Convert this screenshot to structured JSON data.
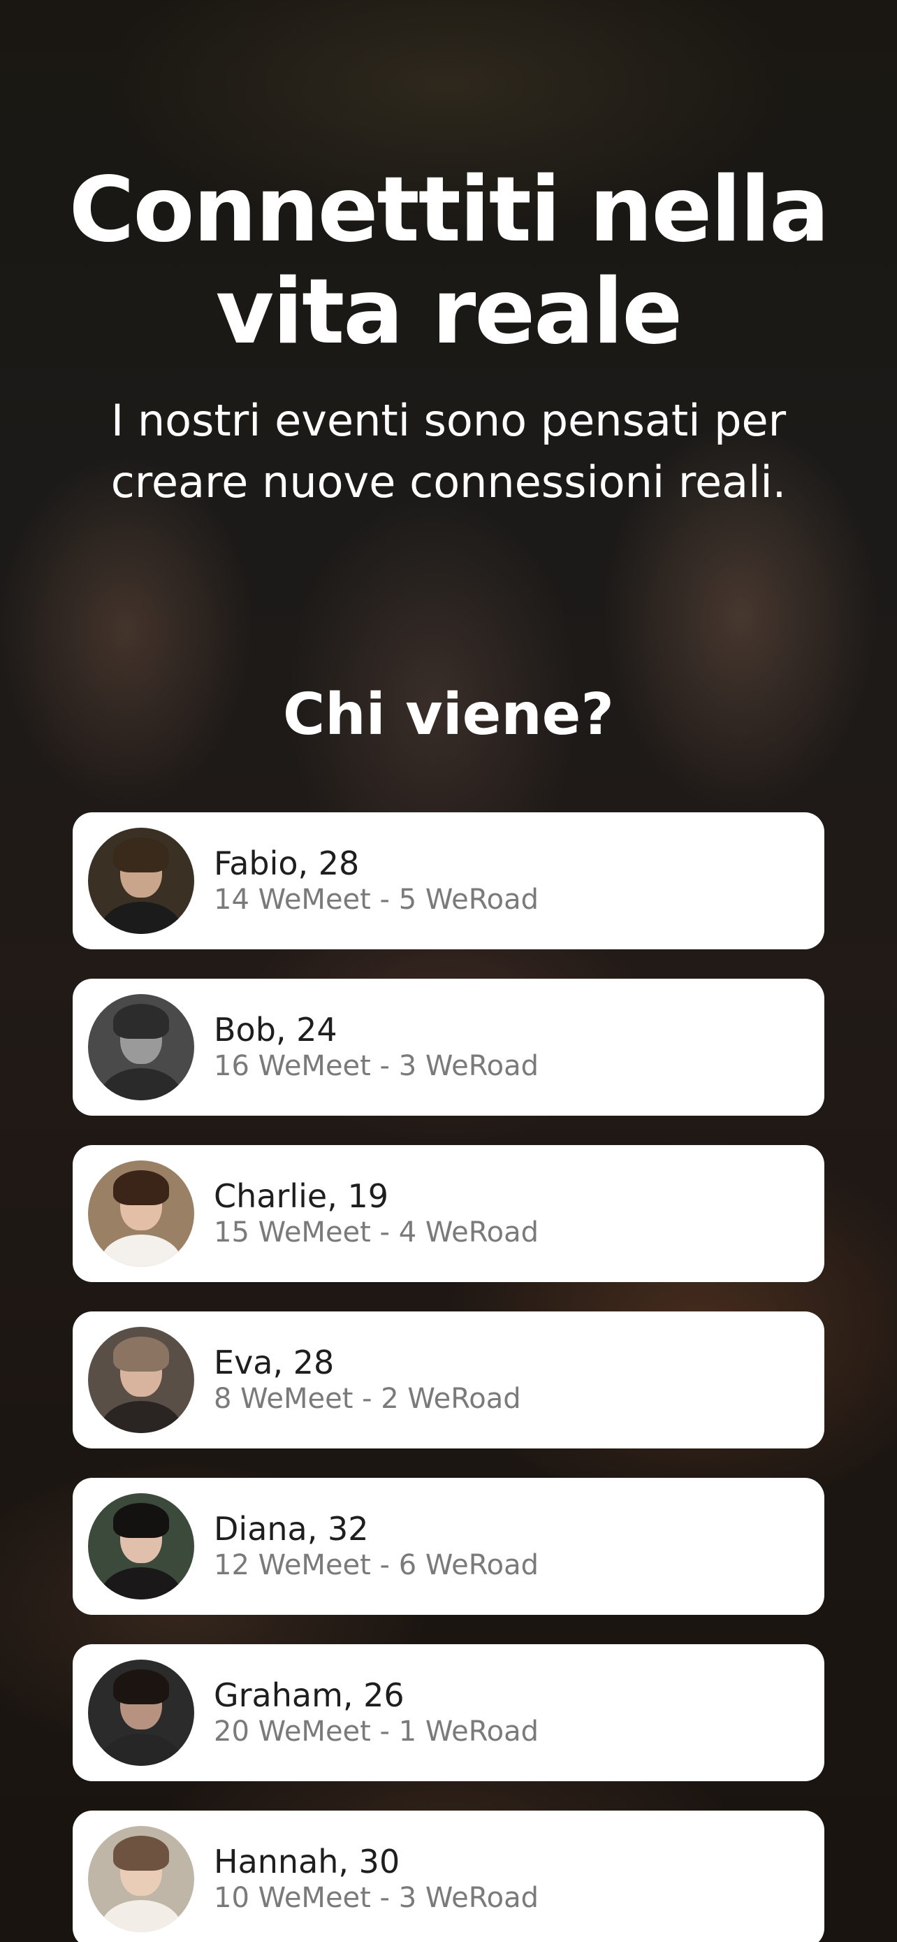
{
  "hero": {
    "title_line1": "Connettiti nella",
    "title_line2": "vita reale",
    "subtitle_line1": "I nostri eventi sono pensati per",
    "subtitle_line2": "creare nuove connessioni reali."
  },
  "section": {
    "title": "Chi viene?"
  },
  "attendees": [
    {
      "name": "Fabio, 28",
      "stats": "14 WeMeet - 5 WeRoad",
      "avatar_bg": "#3a3124",
      "avatar_skin": "#c9a58c",
      "avatar_hair": "#3a2a1c",
      "avatar_shirt": "#1b1b1b"
    },
    {
      "name": "Bob, 24",
      "stats": "16 WeMeet - 3 WeRoad",
      "avatar_bg": "#4a4a4a",
      "avatar_skin": "#9a9a9a",
      "avatar_hair": "#2c2c2c",
      "avatar_shirt": "#2a2a2a"
    },
    {
      "name": "Charlie, 19",
      "stats": "15 WeMeet - 4 WeRoad",
      "avatar_bg": "#9a8064",
      "avatar_skin": "#e2bfa6",
      "avatar_hair": "#3b2518",
      "avatar_shirt": "#f4f1ec"
    },
    {
      "name": "Eva, 28",
      "stats": "8 WeMeet - 2 WeRoad",
      "avatar_bg": "#5a4f46",
      "avatar_skin": "#d8b39e",
      "avatar_hair": "#8b7462",
      "avatar_shirt": "#2a2422"
    },
    {
      "name": "Diana, 32",
      "stats": "12 WeMeet - 6 WeRoad",
      "avatar_bg": "#3b4a3b",
      "avatar_skin": "#e0c0ad",
      "avatar_hair": "#141210",
      "avatar_shirt": "#1a1818"
    },
    {
      "name": "Graham, 26",
      "stats": "20 WeMeet - 1 WeRoad",
      "avatar_bg": "#2b2b2b",
      "avatar_skin": "#b89280",
      "avatar_hair": "#1c1410",
      "avatar_shirt": "#262626"
    },
    {
      "name": "Hannah, 30",
      "stats": "10 WeMeet - 3 WeRoad",
      "avatar_bg": "#bfb6a8",
      "avatar_skin": "#e9cdb6",
      "avatar_hair": "#6e5340",
      "avatar_shirt": "#f2ede6"
    }
  ]
}
